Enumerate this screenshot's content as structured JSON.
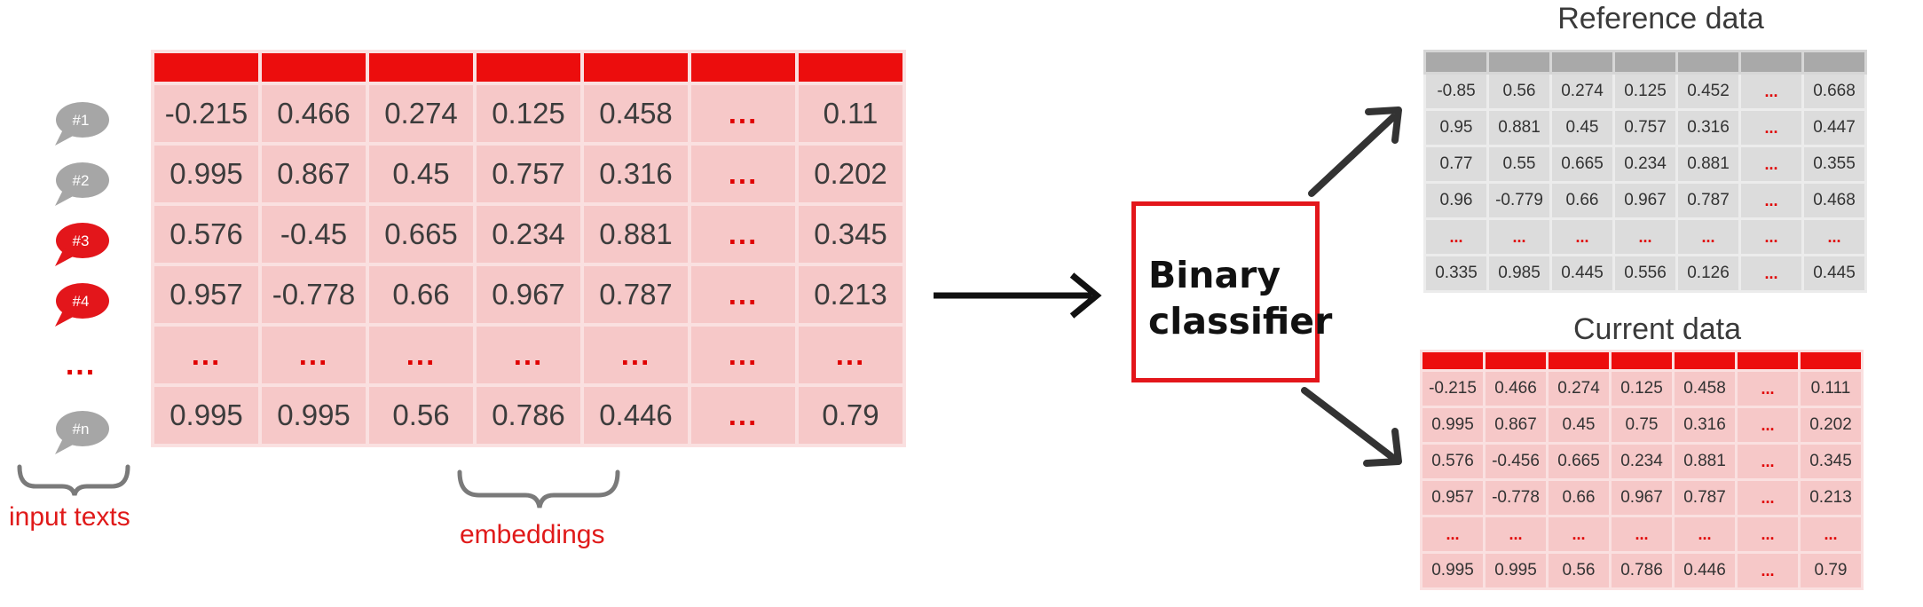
{
  "embeddings": {
    "rows": [
      [
        "-0.215",
        "0.466",
        "0.274",
        "0.125",
        "0.458",
        "...",
        "0.11"
      ],
      [
        "0.995",
        "0.867",
        "0.45",
        "0.757",
        "0.316",
        "...",
        "0.202"
      ],
      [
        "0.576",
        "-0.45",
        "0.665",
        "0.234",
        "0.881",
        "...",
        "0.345"
      ],
      [
        "0.957",
        "-0.778",
        "0.66",
        "0.967",
        "0.787",
        "...",
        "0.213"
      ],
      [
        "...",
        "...",
        "...",
        "...",
        "...",
        "...",
        "..."
      ],
      [
        "0.995",
        "0.995",
        "0.56",
        "0.786",
        "0.446",
        "...",
        "0.79"
      ]
    ]
  },
  "inputs": {
    "bubbles": [
      {
        "label": "#1",
        "color": "#a6a6a6"
      },
      {
        "label": "#2",
        "color": "#a6a6a6"
      },
      {
        "label": "#3",
        "color": "#e3161b"
      },
      {
        "label": "#4",
        "color": "#e3161b"
      },
      {
        "label": "#n",
        "color": "#a6a6a6"
      }
    ],
    "row_dots": "...",
    "caption": "input texts"
  },
  "embeddings_caption": "embeddings",
  "classifier": {
    "label": "Binary classifier"
  },
  "reference": {
    "title": "Reference data",
    "rows": [
      [
        "-0.85",
        "0.56",
        "0.274",
        "0.125",
        "0.452",
        "...",
        "0.668"
      ],
      [
        "0.95",
        "0.881",
        "0.45",
        "0.757",
        "0.316",
        "...",
        "0.447"
      ],
      [
        "0.77",
        "0.55",
        "0.665",
        "0.234",
        "0.881",
        "...",
        "0.355"
      ],
      [
        "0.96",
        "-0.779",
        "0.66",
        "0.967",
        "0.787",
        "...",
        "0.468"
      ],
      [
        "...",
        "...",
        "...",
        "...",
        "...",
        "...",
        "..."
      ],
      [
        "0.335",
        "0.985",
        "0.445",
        "0.556",
        "0.126",
        "...",
        "0.445"
      ]
    ]
  },
  "current": {
    "title": "Current data",
    "rows": [
      [
        "-0.215",
        "0.466",
        "0.274",
        "0.125",
        "0.458",
        "...",
        "0.111"
      ],
      [
        "0.995",
        "0.867",
        "0.45",
        "0.75",
        "0.316",
        "...",
        "0.202"
      ],
      [
        "0.576",
        "-0.456",
        "0.665",
        "0.234",
        "0.881",
        "...",
        "0.345"
      ],
      [
        "0.957",
        "-0.778",
        "0.66",
        "0.967",
        "0.787",
        "...",
        "0.213"
      ],
      [
        "...",
        "...",
        "...",
        "...",
        "...",
        "...",
        "..."
      ],
      [
        "0.995",
        "0.995",
        "0.56",
        "0.786",
        "0.446",
        "...",
        "0.79"
      ]
    ]
  },
  "colors": {
    "accent_red": "#e3161b",
    "table_pink": "#f6c8c8",
    "reference_gray": "#dcdcdc"
  }
}
